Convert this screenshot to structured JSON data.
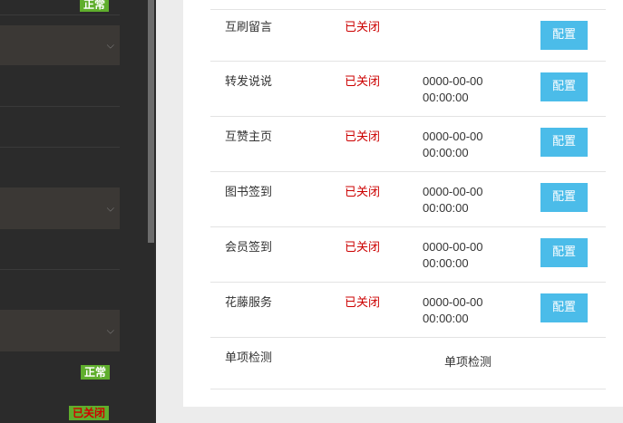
{
  "sidebar": {
    "top_badge": "正常",
    "mid_badge": "正常",
    "bottom_badge": "已关闭",
    "chevron_icon": "chevron-down-icon"
  },
  "table": {
    "first_row": {
      "name": "互刷留言",
      "status": "已关闭",
      "button": "配置"
    },
    "rows": [
      {
        "name": "转发说说",
        "status": "已关闭",
        "date": "0000-00-00",
        "time": "00:00:00",
        "button": "配置"
      },
      {
        "name": "互赞主页",
        "status": "已关闭",
        "date": "0000-00-00",
        "time": "00:00:00",
        "button": "配置"
      },
      {
        "name": "图书签到",
        "status": "已关闭",
        "date": "0000-00-00",
        "time": "00:00:00",
        "button": "配置"
      },
      {
        "name": "会员签到",
        "status": "已关闭",
        "date": "0000-00-00",
        "time": "00:00:00",
        "button": "配置"
      },
      {
        "name": "花藤服务",
        "status": "已关闭",
        "date": "0000-00-00",
        "time": "00:00:00",
        "button": "配置"
      }
    ],
    "last_row": {
      "name": "单项检测",
      "action": "单项检测"
    }
  },
  "colors": {
    "sidebar_bg": "#2b2b2b",
    "badge_green": "#5fae2c",
    "status_red": "#cc0000",
    "button_blue": "#4bbce9"
  }
}
